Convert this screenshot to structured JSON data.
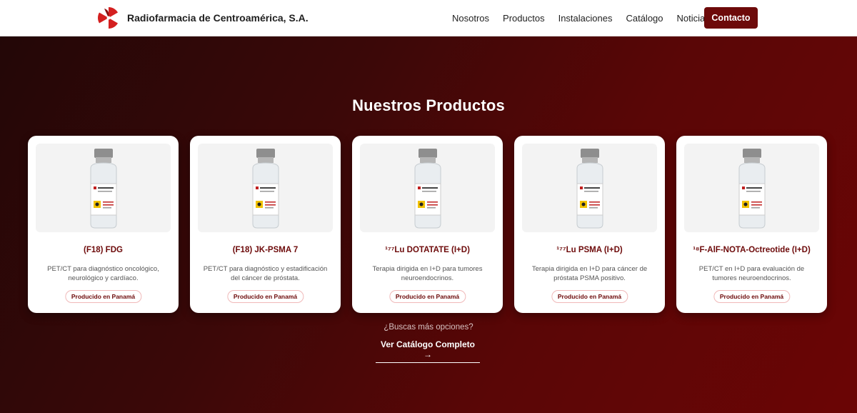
{
  "header": {
    "brand_name": "Radiofarmacia de Centroamérica, S.A.",
    "nav": [
      "Nosotros",
      "Productos",
      "Instalaciones",
      "Catálogo",
      "Noticias"
    ],
    "cta": "Contacto"
  },
  "main": {
    "title": "Nuestros Productos",
    "products": [
      {
        "title": "(F18) FDG",
        "description": "PET/CT para diagnóstico oncológico, neurológico y cardíaco.",
        "badge": "Producido en Panamá"
      },
      {
        "title": "(F18) JK-PSMA 7",
        "description": "PET/CT para diagnóstico y estadificación del cáncer de próstata.",
        "badge": "Producido en Panamá"
      },
      {
        "title": "¹⁷⁷Lu DOTATATE (I+D)",
        "description": "Terapia dirigida en I+D para tumores neuroendocrinos.",
        "badge": "Producido en Panamá"
      },
      {
        "title": "¹⁷⁷Lu PSMA (I+D)",
        "description": "Terapia dirigida en I+D para cáncer de próstata PSMA positivo.",
        "badge": "Producido en Panamá"
      },
      {
        "title": "¹⁸F-AlF-NOTA-Octreotide (I+D)",
        "description": "PET/CT en I+D para evaluación de tumores neuroendocrinos.",
        "badge": "Producido en Panamá"
      }
    ],
    "more_prompt": "¿Buscas más opciones?",
    "catalog_link": "Ver Catálogo Completo →"
  },
  "colors": {
    "brand": "#6d0a0a",
    "accent_logo": "#d42020"
  },
  "icons": {
    "logo": "radiation-propeller-logo-icon",
    "vial": "radioactive-vial-icon"
  }
}
